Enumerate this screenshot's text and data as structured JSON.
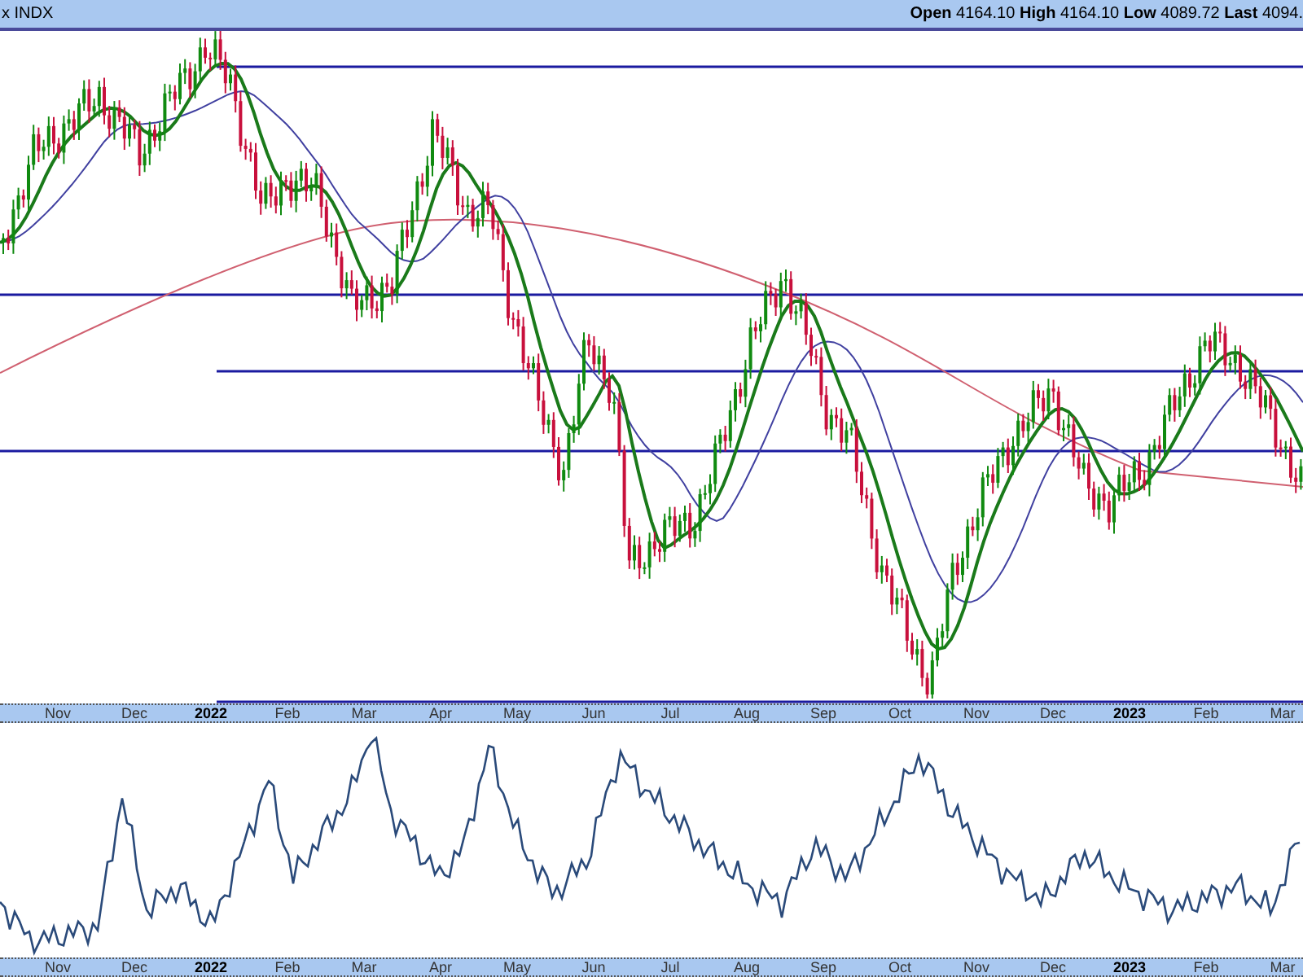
{
  "header": {
    "symbol": "x INDX",
    "quote": "**Open** 4164.10 **High** 4164.10 **Low** 4089.72 **Last** 4094."
  },
  "price_axis": {
    "labels": [
      {
        "text": "Nov",
        "kind": "month"
      },
      {
        "text": "Dec",
        "kind": "month"
      },
      {
        "text": "2022",
        "kind": "year"
      },
      {
        "text": "Feb",
        "kind": "month"
      },
      {
        "text": "Mar",
        "kind": "month"
      },
      {
        "text": "Apr",
        "kind": "month"
      },
      {
        "text": "May",
        "kind": "month"
      },
      {
        "text": "Jun",
        "kind": "month"
      },
      {
        "text": "Jul",
        "kind": "month"
      },
      {
        "text": "Aug",
        "kind": "month"
      },
      {
        "text": "Sep",
        "kind": "month"
      },
      {
        "text": "Oct",
        "kind": "month"
      },
      {
        "text": "Nov",
        "kind": "month"
      },
      {
        "text": "Dec",
        "kind": "month"
      },
      {
        "text": "2023",
        "kind": "year"
      },
      {
        "text": "Feb",
        "kind": "month"
      },
      {
        "text": "Mar",
        "kind": "month"
      }
    ]
  },
  "indicator_axis": {
    "labels": [
      {
        "text": "Nov",
        "kind": "month"
      },
      {
        "text": "Dec",
        "kind": "month"
      },
      {
        "text": "2022",
        "kind": "year"
      },
      {
        "text": "Feb",
        "kind": "month"
      },
      {
        "text": "Mar",
        "kind": "month"
      },
      {
        "text": "Apr",
        "kind": "month"
      },
      {
        "text": "May",
        "kind": "month"
      },
      {
        "text": "Jun",
        "kind": "month"
      },
      {
        "text": "Jul",
        "kind": "month"
      },
      {
        "text": "Aug",
        "kind": "month"
      },
      {
        "text": "Sep",
        "kind": "month"
      },
      {
        "text": "Oct",
        "kind": "month"
      },
      {
        "text": "Nov",
        "kind": "month"
      },
      {
        "text": "Dec",
        "kind": "month"
      },
      {
        "text": "2023",
        "kind": "year"
      },
      {
        "text": "Feb",
        "kind": "month"
      },
      {
        "text": "Mar",
        "kind": "month"
      }
    ]
  }
}
